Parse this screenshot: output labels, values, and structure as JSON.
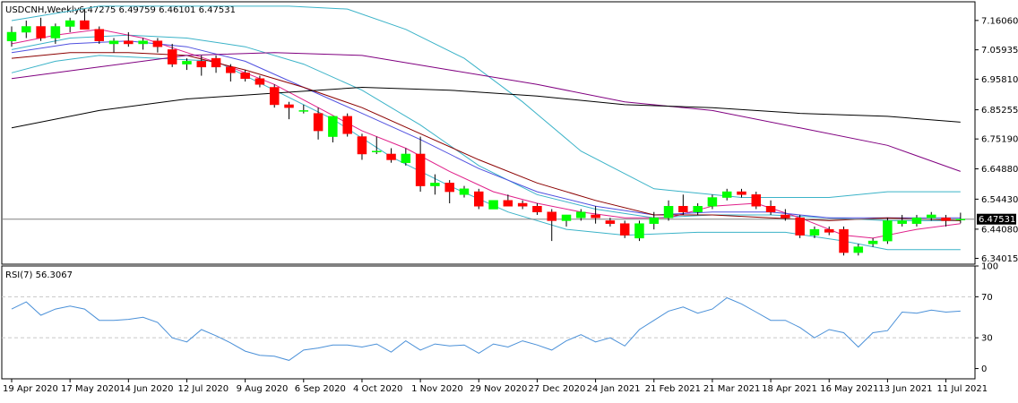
{
  "header": {
    "symbol_tf": "USDCNH,Weekly",
    "ohlc": "6.47275 6.49759 6.46101 6.47531"
  },
  "indicator": {
    "label": "RSI(7) 56.3067"
  },
  "colors": {
    "bull": "#00ff00",
    "bear": "#ff0000",
    "outline": "#000000",
    "bb_band": "#3bb3c8",
    "ma_fast": "#e0208a",
    "ma_mid": "#5050e0",
    "ma_slow": "#8b0000",
    "ma_200": "#000000",
    "ma_purple": "#800080",
    "rsi": "#4a90d8",
    "level": "#c8c8c8"
  },
  "chart_data": [
    {
      "type": "candlestick",
      "name": "price",
      "ylim": [
        6.32,
        7.225
      ],
      "y_ticks": [
        "7.16060",
        "7.05935",
        "6.95810",
        "6.85255",
        "6.75190",
        "6.64880",
        "6.54430",
        "6.44080",
        "6.34015"
      ],
      "y_tick_values": [
        7.1606,
        7.05935,
        6.9581,
        6.85255,
        6.7519,
        6.6488,
        6.5443,
        6.4408,
        6.34015
      ],
      "last_price_label": "6.47531",
      "last_price": 6.47531,
      "x_labels": [
        "19 Apr 2020",
        "17 May 2020",
        "14 Jun 2020",
        "12 Jul 2020",
        "9 Aug 2020",
        "6 Sep 2020",
        "4 Oct 2020",
        "1 Nov 2020",
        "29 Nov 2020",
        "27 Dec 2020",
        "24 Jan 2021",
        "21 Feb 2021",
        "21 Mar 2021",
        "18 Apr 2021",
        "16 May 2021",
        "13 Jun 2021",
        "11 Jul 2021"
      ],
      "x_label_index": [
        0,
        4,
        8,
        12,
        16,
        20,
        24,
        28,
        32,
        36,
        40,
        44,
        48,
        52,
        56,
        60,
        64
      ],
      "ohlc": [
        [
          7.09,
          7.14,
          7.07,
          7.12
        ],
        [
          7.12,
          7.16,
          7.1,
          7.14
        ],
        [
          7.14,
          7.17,
          7.09,
          7.1
        ],
        [
          7.1,
          7.15,
          7.08,
          7.14
        ],
        [
          7.14,
          7.17,
          7.12,
          7.16
        ],
        [
          7.16,
          7.2,
          7.14,
          7.13
        ],
        [
          7.13,
          7.14,
          7.08,
          7.09
        ],
        [
          7.08,
          7.1,
          7.05,
          7.09
        ],
        [
          7.09,
          7.12,
          7.07,
          7.08
        ],
        [
          7.08,
          7.1,
          7.06,
          7.09
        ],
        [
          7.09,
          7.1,
          7.05,
          7.07
        ],
        [
          7.06,
          7.08,
          7.0,
          7.01
        ],
        [
          7.01,
          7.03,
          6.99,
          7.02
        ],
        [
          7.02,
          7.04,
          6.97,
          7.0
        ],
        [
          7.03,
          7.04,
          6.98,
          7.0
        ],
        [
          7.0,
          7.01,
          6.95,
          6.98
        ],
        [
          6.98,
          6.99,
          6.95,
          6.96
        ],
        [
          6.96,
          6.97,
          6.93,
          6.94
        ],
        [
          6.93,
          6.94,
          6.86,
          6.87
        ],
        [
          6.87,
          6.88,
          6.82,
          6.86
        ],
        [
          6.85,
          6.87,
          6.84,
          6.85
        ],
        [
          6.84,
          6.86,
          6.75,
          6.78
        ],
        [
          6.76,
          6.83,
          6.74,
          6.83
        ],
        [
          6.83,
          6.84,
          6.76,
          6.77
        ],
        [
          6.76,
          6.77,
          6.68,
          6.7
        ],
        [
          6.71,
          6.76,
          6.7,
          6.71
        ],
        [
          6.7,
          6.72,
          6.67,
          6.68
        ],
        [
          6.67,
          6.72,
          6.66,
          6.7
        ],
        [
          6.7,
          6.76,
          6.57,
          6.59
        ],
        [
          6.59,
          6.63,
          6.56,
          6.6
        ],
        [
          6.6,
          6.61,
          6.53,
          6.57
        ],
        [
          6.56,
          6.59,
          6.55,
          6.58
        ],
        [
          6.57,
          6.58,
          6.51,
          6.52
        ],
        [
          6.51,
          6.54,
          6.51,
          6.54
        ],
        [
          6.54,
          6.56,
          6.52,
          6.52
        ],
        [
          6.53,
          6.54,
          6.51,
          6.52
        ],
        [
          6.52,
          6.53,
          6.49,
          6.5
        ],
        [
          6.5,
          6.51,
          6.4,
          6.47
        ],
        [
          6.47,
          6.49,
          6.45,
          6.49
        ],
        [
          6.48,
          6.51,
          6.47,
          6.5
        ],
        [
          6.49,
          6.52,
          6.46,
          6.48
        ],
        [
          6.47,
          6.48,
          6.45,
          6.46
        ],
        [
          6.46,
          6.47,
          6.41,
          6.42
        ],
        [
          6.41,
          6.47,
          6.4,
          6.46
        ],
        [
          6.46,
          6.5,
          6.44,
          6.48
        ],
        [
          6.48,
          6.54,
          6.47,
          6.52
        ],
        [
          6.52,
          6.56,
          6.49,
          6.5
        ],
        [
          6.5,
          6.53,
          6.49,
          6.52
        ],
        [
          6.52,
          6.56,
          6.51,
          6.55
        ],
        [
          6.55,
          6.58,
          6.54,
          6.57
        ],
        [
          6.57,
          6.58,
          6.55,
          6.56
        ],
        [
          6.56,
          6.57,
          6.51,
          6.52
        ],
        [
          6.52,
          6.54,
          6.49,
          6.5
        ],
        [
          6.49,
          6.51,
          6.47,
          6.48
        ],
        [
          6.48,
          6.49,
          6.41,
          6.42
        ],
        [
          6.42,
          6.45,
          6.41,
          6.44
        ],
        [
          6.44,
          6.45,
          6.42,
          6.43
        ],
        [
          6.44,
          6.45,
          6.35,
          6.36
        ],
        [
          6.36,
          6.39,
          6.35,
          6.38
        ],
        [
          6.39,
          6.41,
          6.38,
          6.4
        ],
        [
          6.4,
          6.48,
          6.39,
          6.47
        ],
        [
          6.46,
          6.49,
          6.45,
          6.47
        ],
        [
          6.46,
          6.49,
          6.45,
          6.48
        ],
        [
          6.48,
          6.5,
          6.47,
          6.49
        ],
        [
          6.48,
          6.49,
          6.45,
          6.47
        ],
        [
          6.47275,
          6.49759,
          6.46101,
          6.47531
        ]
      ],
      "overlays": {
        "bb_upper": [
          [
            0,
            7.16
          ],
          [
            6,
            7.21
          ],
          [
            12,
            7.21
          ],
          [
            19,
            7.21
          ],
          [
            23,
            7.2
          ],
          [
            27,
            7.13
          ],
          [
            31,
            7.03
          ],
          [
            35,
            6.88
          ],
          [
            39,
            6.71
          ],
          [
            44,
            6.58
          ],
          [
            50,
            6.55
          ],
          [
            56,
            6.55
          ],
          [
            60,
            6.57
          ],
          [
            64,
            6.57
          ],
          [
            65,
            6.57
          ]
        ],
        "bb_lower": [
          [
            0,
            6.98
          ],
          [
            3,
            7.02
          ],
          [
            6,
            7.04
          ],
          [
            10,
            7.03
          ],
          [
            14,
            7.02
          ],
          [
            18,
            6.92
          ],
          [
            22,
            6.82
          ],
          [
            26,
            6.69
          ],
          [
            30,
            6.59
          ],
          [
            34,
            6.5
          ],
          [
            38,
            6.44
          ],
          [
            42,
            6.42
          ],
          [
            47,
            6.43
          ],
          [
            53,
            6.43
          ],
          [
            57,
            6.4
          ],
          [
            60,
            6.37
          ],
          [
            65,
            6.37
          ]
        ],
        "bb_mid": [
          [
            0,
            7.06
          ],
          [
            4,
            7.1
          ],
          [
            8,
            7.11
          ],
          [
            12,
            7.1
          ],
          [
            16,
            7.07
          ],
          [
            20,
            7.01
          ],
          [
            24,
            6.92
          ],
          [
            28,
            6.8
          ],
          [
            32,
            6.66
          ],
          [
            36,
            6.56
          ],
          [
            40,
            6.51
          ],
          [
            44,
            6.48
          ],
          [
            48,
            6.49
          ],
          [
            52,
            6.49
          ],
          [
            56,
            6.48
          ],
          [
            60,
            6.47
          ],
          [
            65,
            6.47
          ]
        ],
        "ma_fast": [
          [
            0,
            7.08
          ],
          [
            3,
            7.11
          ],
          [
            6,
            7.13
          ],
          [
            9,
            7.1
          ],
          [
            12,
            7.05
          ],
          [
            15,
            7.0
          ],
          [
            18,
            6.94
          ],
          [
            21,
            6.86
          ],
          [
            24,
            6.78
          ],
          [
            27,
            6.72
          ],
          [
            30,
            6.64
          ],
          [
            33,
            6.57
          ],
          [
            36,
            6.53
          ],
          [
            39,
            6.5
          ],
          [
            42,
            6.48
          ],
          [
            45,
            6.48
          ],
          [
            48,
            6.52
          ],
          [
            51,
            6.53
          ],
          [
            54,
            6.48
          ],
          [
            57,
            6.42
          ],
          [
            59,
            6.41
          ],
          [
            62,
            6.44
          ],
          [
            65,
            6.46
          ]
        ],
        "ma_mid": [
          [
            0,
            7.05
          ],
          [
            4,
            7.08
          ],
          [
            8,
            7.09
          ],
          [
            12,
            7.07
          ],
          [
            16,
            7.02
          ],
          [
            20,
            6.93
          ],
          [
            24,
            6.84
          ],
          [
            28,
            6.75
          ],
          [
            32,
            6.65
          ],
          [
            36,
            6.57
          ],
          [
            40,
            6.52
          ],
          [
            44,
            6.49
          ],
          [
            48,
            6.5
          ],
          [
            52,
            6.5
          ],
          [
            56,
            6.48
          ],
          [
            60,
            6.48
          ],
          [
            65,
            6.48
          ]
        ],
        "ma_slow": [
          [
            0,
            7.03
          ],
          [
            4,
            7.05
          ],
          [
            8,
            7.05
          ],
          [
            12,
            7.04
          ],
          [
            16,
            6.99
          ],
          [
            20,
            6.93
          ],
          [
            24,
            6.86
          ],
          [
            28,
            6.77
          ],
          [
            32,
            6.68
          ],
          [
            36,
            6.6
          ],
          [
            40,
            6.54
          ],
          [
            44,
            6.49
          ],
          [
            48,
            6.49
          ],
          [
            52,
            6.48
          ],
          [
            56,
            6.47
          ],
          [
            60,
            6.48
          ],
          [
            65,
            6.47
          ]
        ],
        "ma_purple": [
          [
            0,
            6.96
          ],
          [
            6,
            7.0
          ],
          [
            12,
            7.04
          ],
          [
            18,
            7.05
          ],
          [
            24,
            7.04
          ],
          [
            30,
            6.99
          ],
          [
            36,
            6.94
          ],
          [
            42,
            6.88
          ],
          [
            48,
            6.85
          ],
          [
            54,
            6.79
          ],
          [
            60,
            6.73
          ],
          [
            65,
            6.64
          ]
        ],
        "ma_200": [
          [
            0,
            6.79
          ],
          [
            6,
            6.85
          ],
          [
            12,
            6.89
          ],
          [
            18,
            6.91
          ],
          [
            24,
            6.93
          ],
          [
            30,
            6.92
          ],
          [
            36,
            6.9
          ],
          [
            42,
            6.87
          ],
          [
            48,
            6.86
          ],
          [
            54,
            6.84
          ],
          [
            60,
            6.83
          ],
          [
            65,
            6.81
          ]
        ]
      }
    },
    {
      "type": "line",
      "name": "rsi",
      "ylim": [
        -10,
        100
      ],
      "y_ticks": [
        "100",
        "70",
        "30",
        "0"
      ],
      "y_tick_values": [
        100,
        70,
        30,
        0
      ],
      "levels": [
        70,
        30
      ],
      "values": [
        58,
        65,
        52,
        58,
        61,
        58,
        47,
        47,
        48,
        50,
        45,
        30,
        26,
        38,
        32,
        25,
        17,
        13,
        12,
        8,
        18,
        20,
        23,
        23,
        21,
        24,
        16,
        27,
        18,
        24,
        22,
        23,
        15,
        24,
        21,
        27,
        23,
        18,
        27,
        33,
        26,
        30,
        22,
        38,
        47,
        56,
        60,
        54,
        58,
        69,
        63,
        55,
        47,
        47,
        40,
        30,
        38,
        35,
        21,
        35,
        37,
        55,
        54,
        57,
        55,
        56
      ]
    }
  ]
}
